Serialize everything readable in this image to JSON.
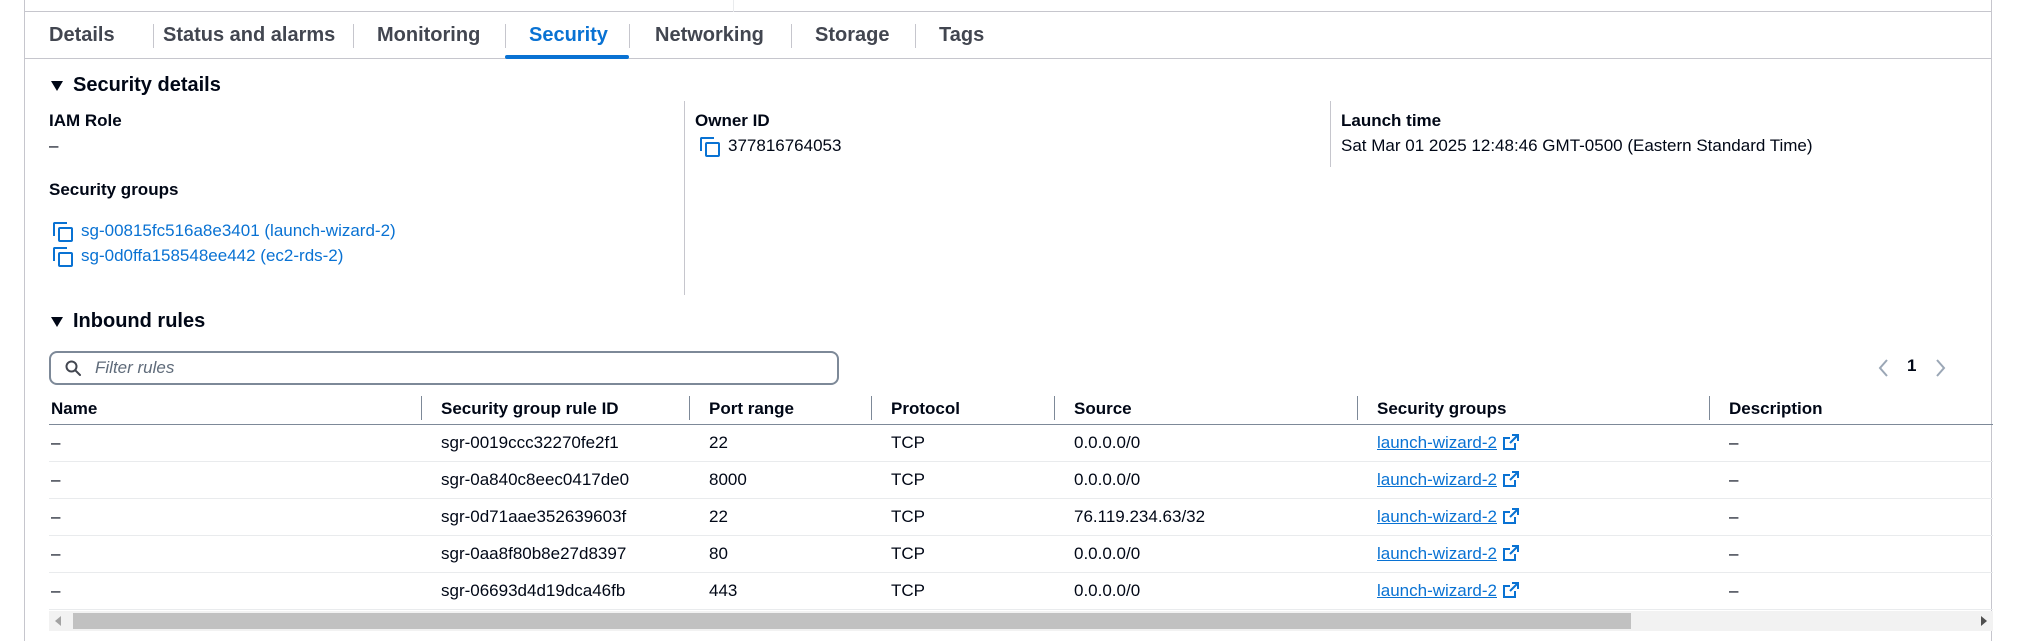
{
  "tabs": [
    {
      "label": "Details"
    },
    {
      "label": "Status and alarms"
    },
    {
      "label": "Monitoring"
    },
    {
      "label": "Security"
    },
    {
      "label": "Networking"
    },
    {
      "label": "Storage"
    },
    {
      "label": "Tags"
    }
  ],
  "active_tab": "Security",
  "security_details": {
    "title": "Security details",
    "iam_role_label": "IAM Role",
    "iam_role_value": "–",
    "owner_id_label": "Owner ID",
    "owner_id_value": "377816764053",
    "launch_time_label": "Launch time",
    "launch_time_value": "Sat Mar 01 2025 12:48:46 GMT-0500 (Eastern Standard Time)",
    "security_groups_label": "Security groups",
    "security_groups": [
      "sg-00815fc516a8e3401 (launch-wizard-2)",
      "sg-0d0ffa158548ee442 (ec2-rds-2)"
    ]
  },
  "inbound_rules": {
    "title": "Inbound rules",
    "filter_placeholder": "Filter rules",
    "current_page": "1",
    "columns": [
      "Name",
      "Security group rule ID",
      "Port range",
      "Protocol",
      "Source",
      "Security groups",
      "Description"
    ],
    "rows": [
      {
        "name": "–",
        "rule_id": "sgr-0019ccc32270fe2f1",
        "port": "22",
        "protocol": "TCP",
        "source": "0.0.0.0/0",
        "group": "launch-wizard-2",
        "description": "–"
      },
      {
        "name": "–",
        "rule_id": "sgr-0a840c8eec0417de0",
        "port": "8000",
        "protocol": "TCP",
        "source": "0.0.0.0/0",
        "group": "launch-wizard-2",
        "description": "–"
      },
      {
        "name": "–",
        "rule_id": "sgr-0d71aae352639603f",
        "port": "22",
        "protocol": "TCP",
        "source": "76.119.234.63/32",
        "group": "launch-wizard-2",
        "description": "–"
      },
      {
        "name": "–",
        "rule_id": "sgr-0aa8f80b8e27d8397",
        "port": "80",
        "protocol": "TCP",
        "source": "0.0.0.0/0",
        "group": "launch-wizard-2",
        "description": "–"
      },
      {
        "name": "–",
        "rule_id": "sgr-06693d4d19dca46fb",
        "port": "443",
        "protocol": "TCP",
        "source": "0.0.0.0/0",
        "group": "launch-wizard-2",
        "description": "–"
      }
    ]
  },
  "colors": {
    "accent": "#0972d3",
    "text": "#000716",
    "border": "#c6c6cd"
  }
}
